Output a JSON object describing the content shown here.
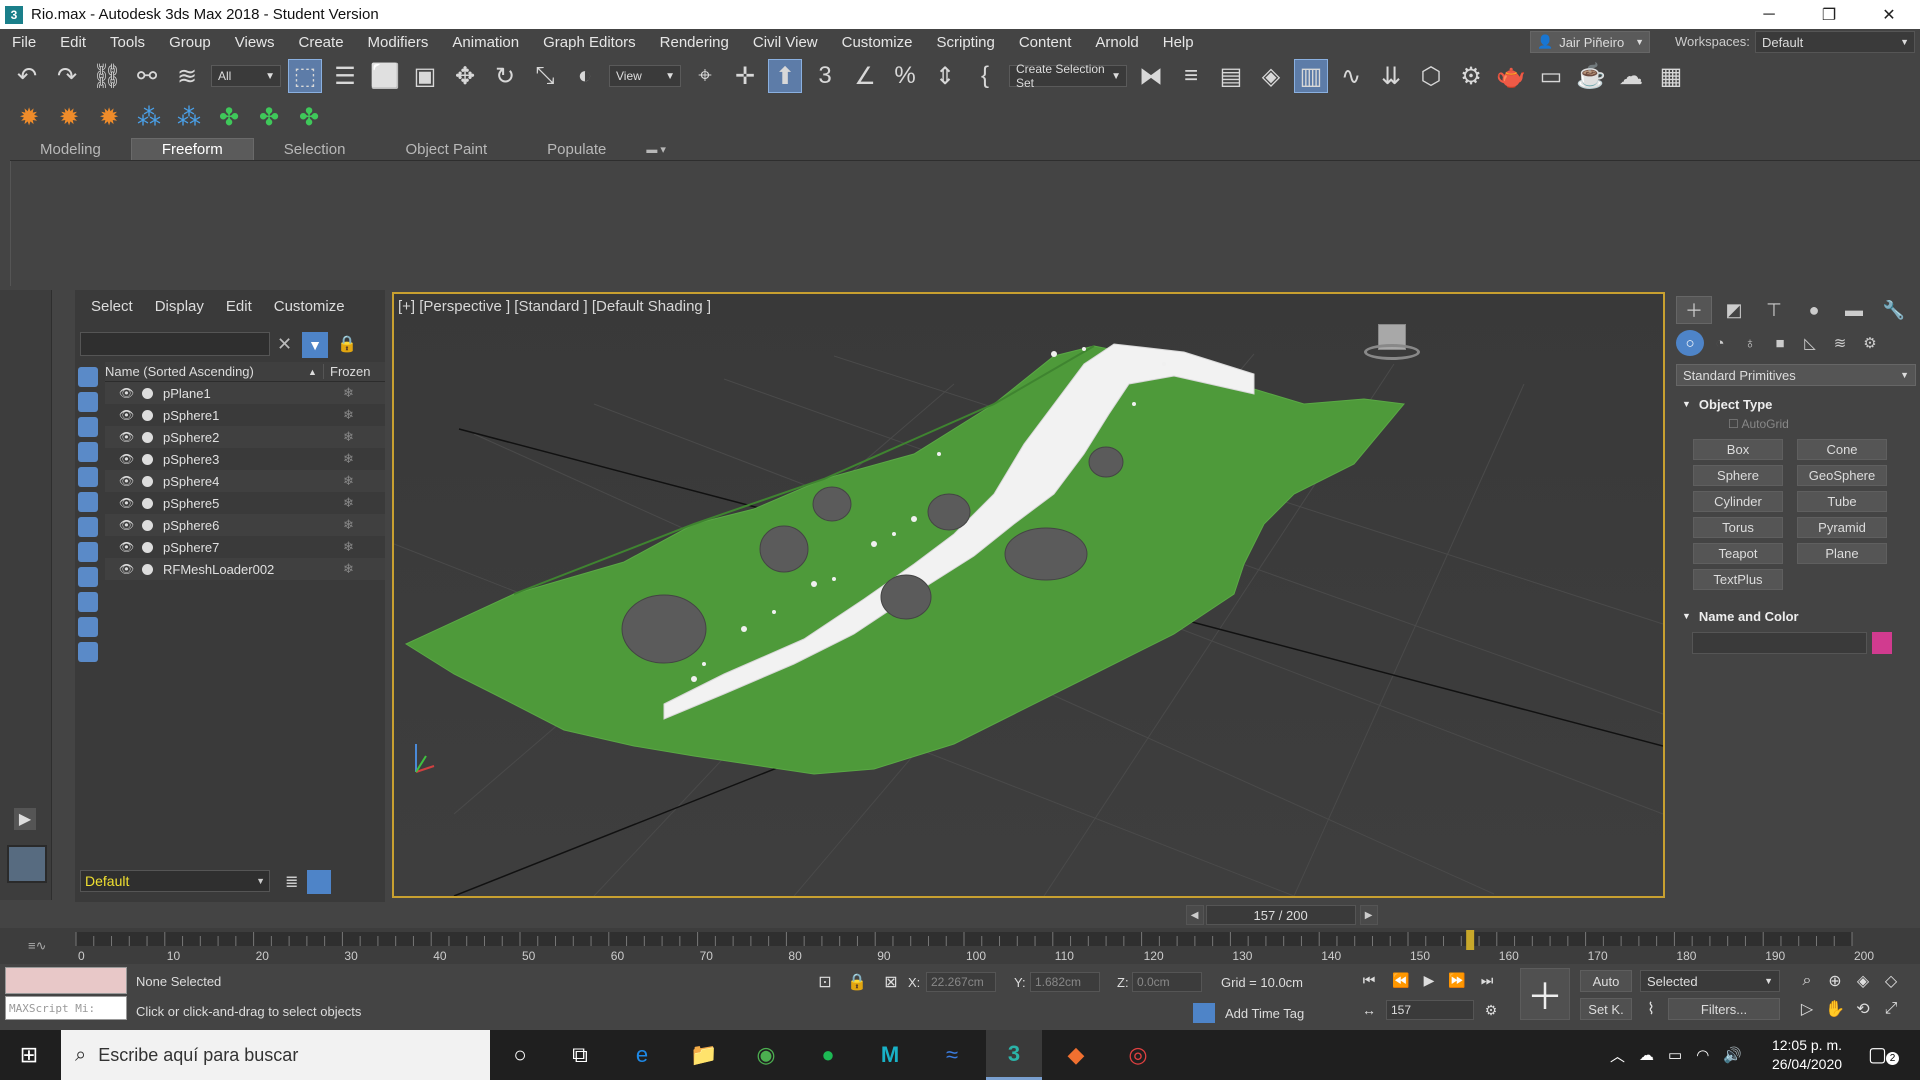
{
  "window": {
    "title": "Rio.max - Autodesk 3ds Max 2018 - Student Version",
    "minimize": "─",
    "maximize": "❐",
    "close": "✕"
  },
  "menu": [
    "File",
    "Edit",
    "Tools",
    "Group",
    "Views",
    "Create",
    "Modifiers",
    "Animation",
    "Graph Editors",
    "Rendering",
    "Civil View",
    "Customize",
    "Scripting",
    "Content",
    "Arnold",
    "Help"
  ],
  "user": "Jair Piñeiro",
  "workspaces": {
    "label": "Workspaces:",
    "value": "Default"
  },
  "toolbar": {
    "selection_filter": "All",
    "ref_coord": "View",
    "selection_set": "Create Selection Set"
  },
  "ribbon": {
    "tabs": [
      "Modeling",
      "Freeform",
      "Selection",
      "Object Paint",
      "Populate"
    ],
    "active": "Freeform"
  },
  "scene_explorer": {
    "menu": [
      "Select",
      "Display",
      "Edit",
      "Customize"
    ],
    "col_name": "Name (Sorted Ascending)",
    "col_frozen": "Frozen",
    "sort_arrow": "▲",
    "objects": [
      "pPlane1",
      "pSphere1",
      "pSphere2",
      "pSphere3",
      "pSphere4",
      "pSphere5",
      "pSphere6",
      "pSphere7",
      "RFMeshLoader002"
    ],
    "layer": "Default"
  },
  "viewport": {
    "label": "[+] [Perspective ] [Standard ] [Default Shading ]"
  },
  "command_panel": {
    "category": "Standard Primitives",
    "object_type_title": "Object Type",
    "autogrid": "AutoGrid",
    "primitives": [
      "Box",
      "Cone",
      "Sphere",
      "GeoSphere",
      "Cylinder",
      "Tube",
      "Torus",
      "Pyramid",
      "Teapot",
      "Plane",
      "TextPlus"
    ],
    "name_color_title": "Name and Color",
    "color": "#d13b8f"
  },
  "time": {
    "frame_display": "157 / 200",
    "current_frame": 157,
    "total_frames": 200,
    "tick_labels": [
      "0",
      "10",
      "20",
      "30",
      "40",
      "50",
      "60",
      "70",
      "80",
      "90",
      "100",
      "110",
      "120",
      "130",
      "140",
      "150",
      "160",
      "170",
      "180",
      "190",
      "200"
    ]
  },
  "status": {
    "maxscript": "MAXScript Mi:",
    "selection": "None Selected",
    "prompt": "Click or click-and-drag to select objects",
    "x_label": "X:",
    "x": "22.267cm",
    "y_label": "Y:",
    "y": "1.682cm",
    "z_label": "Z:",
    "z": "0.0cm",
    "grid": "Grid = 10.0cm",
    "add_time_tag": "Add Time Tag",
    "frame_field": "157",
    "auto_key": "Auto",
    "set_key": "Set K.",
    "key_filter": "Selected",
    "filters": "Filters..."
  },
  "taskbar": {
    "search_placeholder": "Escribe aquí para buscar",
    "time": "12:05 p. m.",
    "date": "26/04/2020",
    "notifications": "2"
  }
}
